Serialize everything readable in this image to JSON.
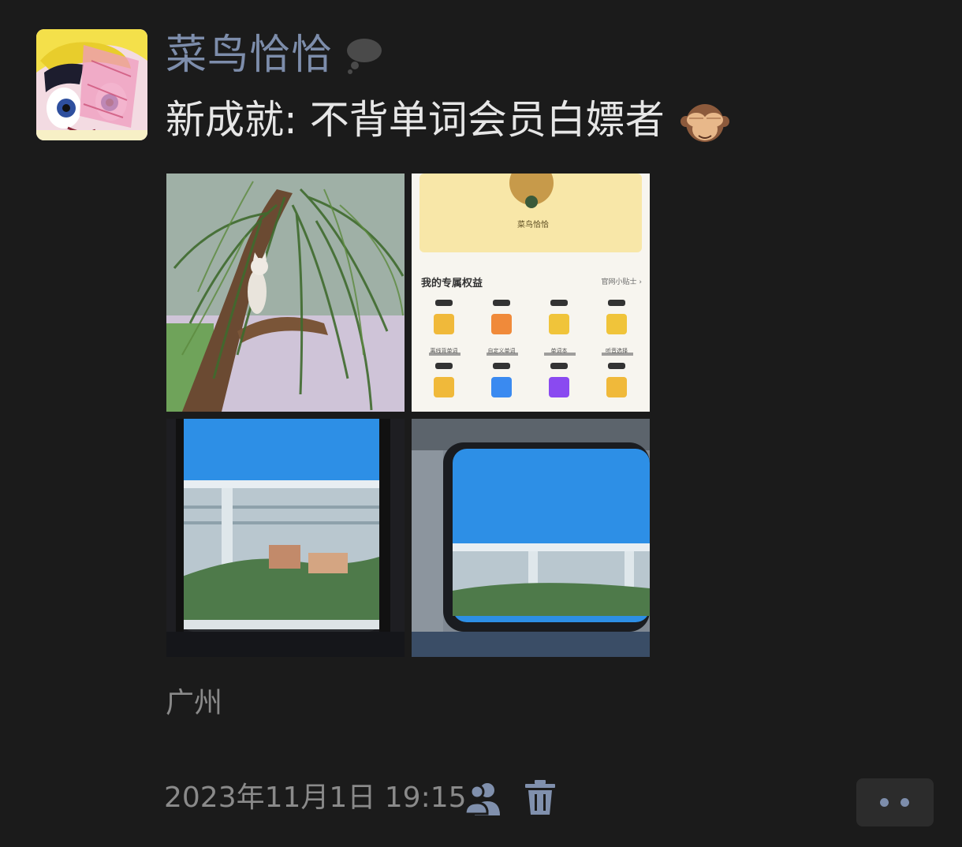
{
  "post": {
    "username": "菜鸟恰恰",
    "text": "新成就: 不背单词会员白嫖者",
    "location": "广州",
    "timestamp": "2023年11月1日 19:15"
  },
  "icons": {
    "status": "thought-bubble-icon",
    "emoji": "see-no-evil-monkey-icon",
    "visibility": "friends-visibility-icon",
    "delete": "trash-icon",
    "more": "more-dots-icon"
  },
  "photos": [
    {
      "name": "cat-in-tree-photo"
    },
    {
      "name": "app-screenshot-photo",
      "profile_name": "菜鸟恰恰",
      "section_title": "我的专属权益",
      "section_link": "官网小贴士 ›",
      "row1_labels": [
        "离线背单词",
        "自定义单词",
        "单词本",
        "听音选择"
      ]
    },
    {
      "name": "train-window-photo-1"
    },
    {
      "name": "train-window-photo-2"
    }
  ],
  "colors": {
    "background": "#1b1b1b",
    "username": "#7d8dab",
    "text": "#e6e6e6",
    "meta": "#8a8a8a"
  }
}
